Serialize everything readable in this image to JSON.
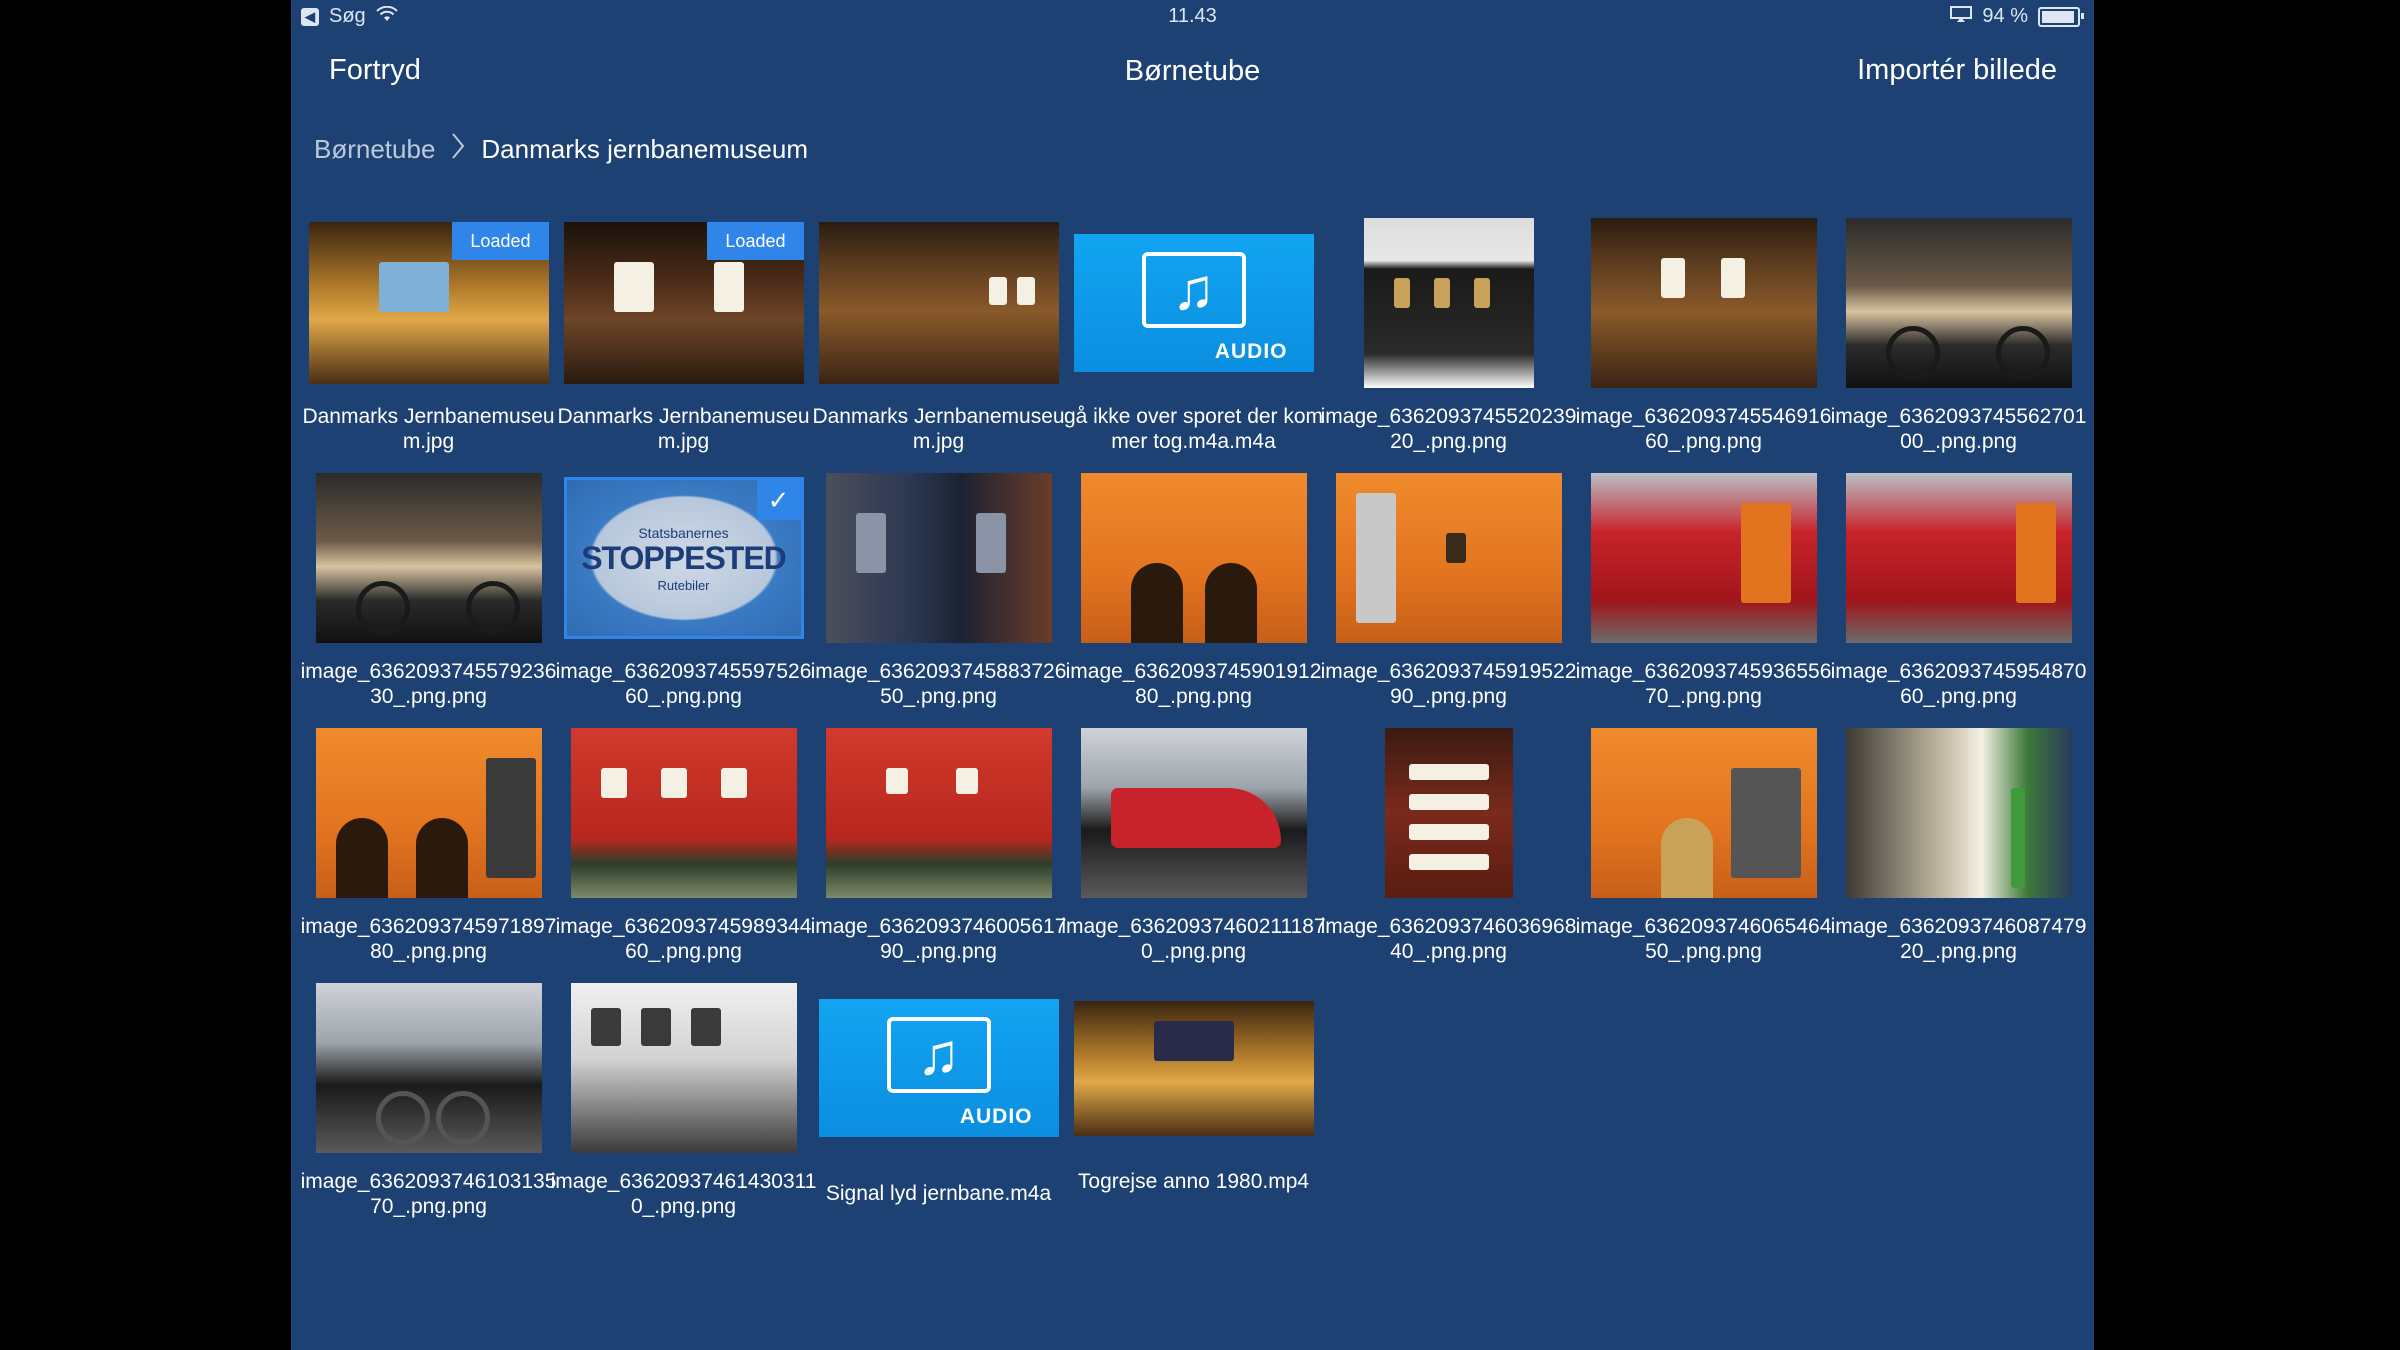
{
  "status_bar": {
    "back_label": "Søg",
    "time": "11.43",
    "battery": "94 %"
  },
  "nav": {
    "cancel_label": "Fortryd",
    "title": "Børnetube",
    "import_label": "Importér billede"
  },
  "breadcrumb": {
    "root": "Børnetube",
    "current": "Danmarks jernbanemuseum"
  },
  "badges": {
    "loaded": "Loaded",
    "audio": "AUDIO"
  },
  "items": [
    {
      "caption": "Danmarks Jernbanemuseum.jpg",
      "kind": "image",
      "loaded": true
    },
    {
      "caption": "Danmarks Jernbanemuseum.jpg",
      "kind": "image",
      "loaded": true
    },
    {
      "caption": "Danmarks Jernbanemuseum.jpg",
      "kind": "image"
    },
    {
      "caption": "gå ikke over sporet der kommer tog.m4a.m4a",
      "kind": "audio"
    },
    {
      "caption": "image_636209374552023920_.png.png",
      "kind": "image"
    },
    {
      "caption": "image_636209374554691660_.png.png",
      "kind": "image"
    },
    {
      "caption": "image_636209374556270100_.png.png",
      "kind": "image"
    },
    {
      "caption": "image_636209374557923630_.png.png",
      "kind": "image"
    },
    {
      "caption": "image_636209374559752660_.png.png",
      "kind": "image",
      "selected": true,
      "art_text_1": "Statsbanernes",
      "art_text_2": "STOPPESTED",
      "art_text_3": "Rutebiler"
    },
    {
      "caption": "image_636209374588372650_.png.png",
      "kind": "image"
    },
    {
      "caption": "image_636209374590191280_.png.png",
      "kind": "image"
    },
    {
      "caption": "image_636209374591952290_.png.png",
      "kind": "image"
    },
    {
      "caption": "image_636209374593655670_.png.png",
      "kind": "image"
    },
    {
      "caption": "image_636209374595487060_.png.png",
      "kind": "image"
    },
    {
      "caption": "image_636209374597189780_.png.png",
      "kind": "image"
    },
    {
      "caption": "image_636209374598934460_.png.png",
      "kind": "image"
    },
    {
      "caption": "image_636209374600561790_.png.png",
      "kind": "image"
    },
    {
      "caption": "image_636209374602111870_.png.png",
      "kind": "image"
    },
    {
      "caption": "image_636209374603696840_.png.png",
      "kind": "image"
    },
    {
      "caption": "image_636209374606546450_.png.png",
      "kind": "image"
    },
    {
      "caption": "image_636209374608747920_.png.png",
      "kind": "image"
    },
    {
      "caption": "image_636209374610313570_.png.png",
      "kind": "image"
    },
    {
      "caption": "image_636209374614303110_.png.png",
      "kind": "image"
    },
    {
      "caption": "Signal lyd jernbane.m4a",
      "kind": "audio"
    },
    {
      "caption": "Togrejse anno 1980.mp4",
      "kind": "video"
    }
  ],
  "colors": {
    "background": "#1d4172",
    "accent": "#2f86e8",
    "audio_tile": "#12a5f1"
  }
}
